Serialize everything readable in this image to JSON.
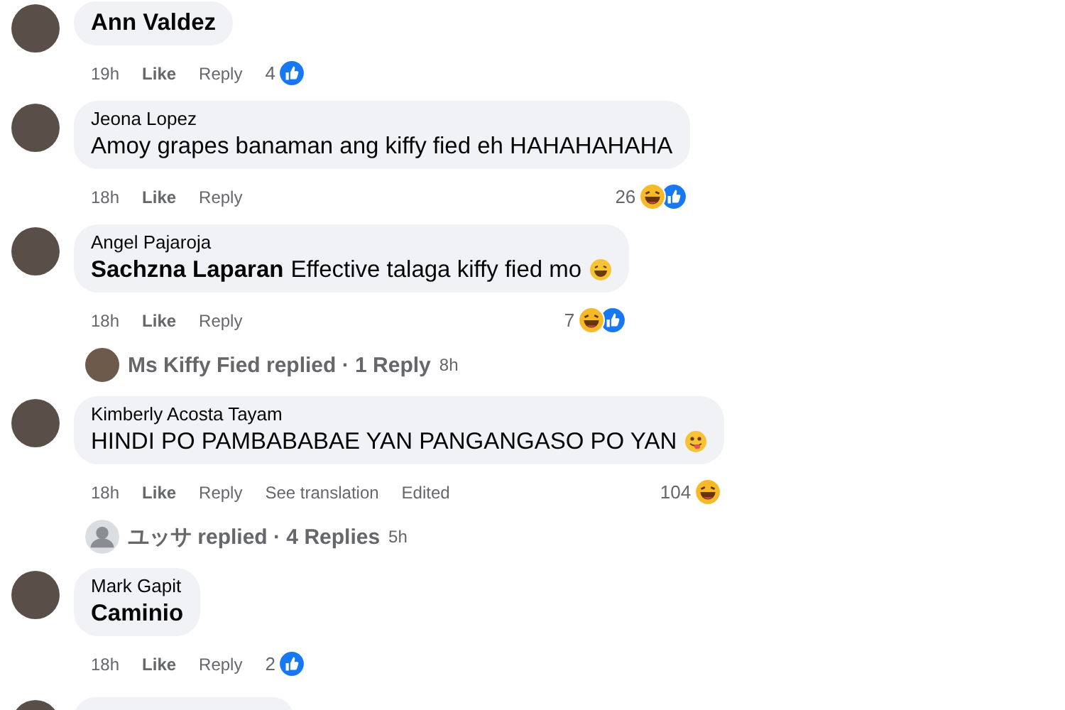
{
  "comments": [
    {
      "mention": "Ann Valdez",
      "time": "19h",
      "actions": [
        "Like",
        "Reply"
      ],
      "reaction_count": "4",
      "reactions": [
        {
          "kind": "like"
        }
      ]
    },
    {
      "author": "Jeona Lopez",
      "text": "Amoy grapes banaman ang kiffy fied eh HAHAHAHAHA",
      "time": "18h",
      "actions": [
        "Like",
        "Reply"
      ],
      "reaction_count": "26",
      "reactions": [
        {
          "kind": "haha"
        },
        {
          "kind": "like"
        }
      ]
    },
    {
      "author": "Angel Pajaroja",
      "mention": "Sachzna Laparan",
      "text": "Effective talaga kiffy fied mo",
      "emoji": {
        "kind": "grin"
      },
      "time": "18h",
      "actions": [
        "Like",
        "Reply"
      ],
      "reaction_count": "7",
      "reactions": [
        {
          "kind": "haha"
        },
        {
          "kind": "like"
        }
      ],
      "replies": {
        "avatar": {
          "kind": "photo"
        },
        "label": "Ms Kiffy Fied replied · 1 Reply",
        "time": "8h"
      }
    },
    {
      "author": "Kimberly Acosta Tayam",
      "text": "HINDI PO PAMBABABAE YAN PANGANGASO PO YAN",
      "emoji": {
        "kind": "tongue"
      },
      "time": "18h",
      "actions": [
        "Like",
        "Reply"
      ],
      "extra": [
        "See translation",
        "Edited"
      ],
      "reaction_count": "104",
      "reactions": [
        {
          "kind": "haha"
        }
      ],
      "replies": {
        "avatar": {
          "kind": "default"
        },
        "label": "ユッサ replied · 4 Replies",
        "time": "5h"
      }
    },
    {
      "author": "Mark Gapit",
      "mention": "Caminio",
      "time": "18h",
      "actions": [
        "Like",
        "Reply"
      ],
      "reaction_count": "2",
      "reactions": [
        {
          "kind": "like"
        }
      ]
    }
  ]
}
